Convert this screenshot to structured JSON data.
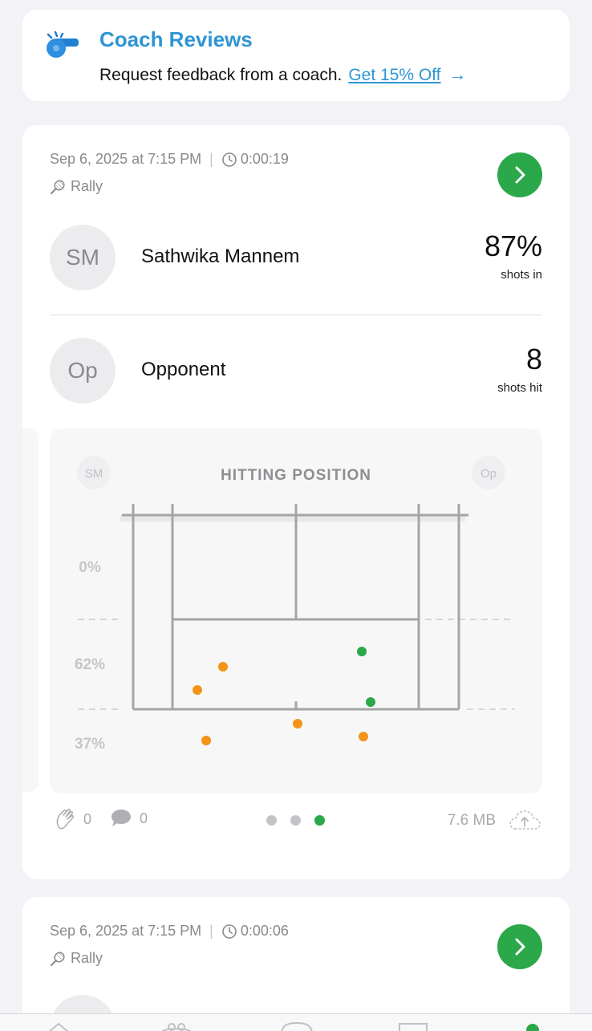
{
  "coach": {
    "title": "Coach Reviews",
    "text": "Request feedback from a coach.",
    "link": "Get 15% Off",
    "arrow": "→",
    "icon": "whistle-icon"
  },
  "sessions": [
    {
      "date": "Sep 6, 2025 at 7:15 PM",
      "duration": "0:00:19",
      "type": "Rally",
      "players": [
        {
          "initials": "SM",
          "name": "Sathwika Mannem",
          "stat_value": "87%",
          "stat_label": "shots in"
        },
        {
          "initials": "Op",
          "name": "Opponent",
          "stat_value": "8",
          "stat_label": "shots hit"
        }
      ],
      "chart": {
        "title": "HITTING POSITION",
        "left_badge": "SM",
        "right_badge": "Op",
        "zones": [
          "0%",
          "62%",
          "37%"
        ]
      },
      "claps": "0",
      "comments": "0",
      "page_count": 3,
      "active_page": 3,
      "file_size": "7.6 MB"
    },
    {
      "date": "Sep 6, 2025 at 7:15 PM",
      "duration": "0:00:06",
      "type": "Rally"
    }
  ],
  "colors": {
    "accent_blue": "#2e95d3",
    "green": "#2aa84a",
    "orange": "#f39317"
  },
  "chart_data": {
    "type": "scatter",
    "title": "HITTING POSITION",
    "series": [
      {
        "name": "SM",
        "color": "#f39317",
        "points": [
          [
            278,
            831
          ],
          [
            246,
            860
          ],
          [
            371,
            902
          ],
          [
            453,
            918
          ],
          [
            257,
            923
          ]
        ]
      },
      {
        "name": "Op",
        "color": "#2aa84a",
        "points": [
          [
            451,
            812
          ],
          [
            462,
            875
          ]
        ]
      }
    ],
    "zone_labels": [
      "0%",
      "62%",
      "37%"
    ]
  }
}
